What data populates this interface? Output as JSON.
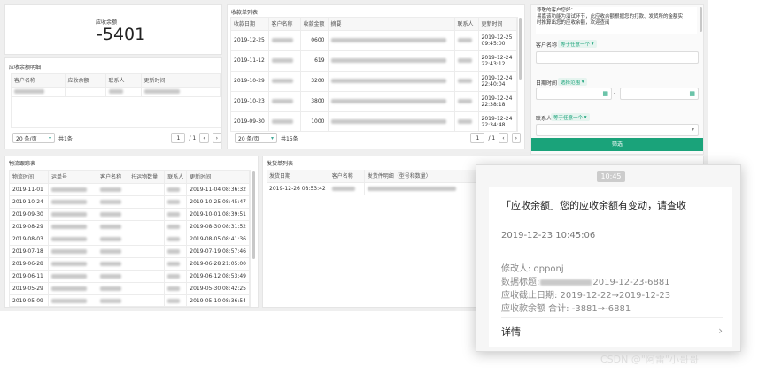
{
  "summary": {
    "label": "应收余额",
    "value": "-5401"
  },
  "receivable_detail": {
    "title": "应收余额明细",
    "columns": [
      "客户名称",
      "应收余额",
      "联系人",
      "更新时间"
    ],
    "rows": 1,
    "page_size": "20 条/页",
    "total": "共1条",
    "page": "1",
    "pages": "/ 1"
  },
  "payments": {
    "title": "收款单列表",
    "columns": [
      "收款日期",
      "客户名称",
      "收款金额",
      "摘要",
      "联系人",
      "更新时间"
    ],
    "rows": [
      {
        "date": "2019-12-25",
        "amount": "0600",
        "time1": "2019-12-25",
        "time2": "09:45:00"
      },
      {
        "date": "2019-11-12",
        "amount": "619",
        "time1": "2019-12-24",
        "time2": "22:43:12"
      },
      {
        "date": "2019-10-29",
        "amount": "3200",
        "time1": "2019-12-24",
        "time2": "22:40:04"
      },
      {
        "date": "2019-10-23",
        "amount": "3800",
        "time1": "2019-12-24",
        "time2": "22:38:18"
      },
      {
        "date": "2019-09-30",
        "amount": "1000",
        "time1": "2019-12-24",
        "time2": "22:34:48"
      },
      {
        "date": "",
        "amount": "",
        "time1": "2019-12-24",
        "time2": ""
      }
    ],
    "page_size": "20 条/页",
    "total": "共15条",
    "page": "1",
    "pages": "/ 1"
  },
  "filter": {
    "greeting": "尊敬的客户您好：",
    "note1": "易嘉该功能为演试环节，此应收余额根据您的打款、发货所的金额实",
    "note2": "时推算出您的应收余额，欢迎查阅",
    "customer_label": "客户名称",
    "customer_tag": "等于任意一个",
    "date_label": "日期时间",
    "date_tag": "选择范围",
    "contact_label": "联系人",
    "contact_tag": "等于任意一个",
    "submit": "筛选"
  },
  "logistics": {
    "title": "物流跟踪表",
    "columns": [
      "物流时间",
      "运单号",
      "客户名称",
      "托运物数量",
      "联系人",
      "更新时间"
    ],
    "rows": [
      {
        "date": "2019-11-01",
        "updated": "2019-11-04 08:36:32"
      },
      {
        "date": "2019-10-24",
        "updated": "2019-10-25 08:45:47"
      },
      {
        "date": "2019-09-30",
        "updated": "2019-10-01 08:39:51"
      },
      {
        "date": "2019-08-29",
        "updated": "2019-08-30 08:31:52"
      },
      {
        "date": "2019-08-03",
        "updated": "2019-08-05 08:41:36"
      },
      {
        "date": "2019-07-18",
        "updated": "2019-07-19 08:57:46"
      },
      {
        "date": "2019-06-28",
        "updated": "2019-06-28 21:05:00"
      },
      {
        "date": "2019-06-11",
        "updated": "2019-06-12 08:53:49"
      },
      {
        "date": "2019-05-29",
        "updated": "2019-05-30 08:42:25"
      },
      {
        "date": "2019-05-09",
        "updated": "2019-05-10 08:36:54"
      }
    ]
  },
  "shipments": {
    "title": "发货单列表",
    "columns": [
      "发货日期",
      "客户名称",
      "发货件明细（型号和数量）"
    ],
    "rows": [
      {
        "date": "2019-12-26 08:53:42"
      }
    ]
  },
  "notification": {
    "time": "10:45",
    "title": "「应收余额」您的应收余额有变动，请查收",
    "timestamp": "2019-12-23 10:45:06",
    "modifier": "修改人: opponj",
    "data_title_label": "数据标题:",
    "data_title_suffix": "2019-12-23-6881",
    "deadline": "应收截止日期: 2019-12-22→2019-12-23",
    "balance": "应收款余额 合计: -3881→-6881",
    "details": "详情"
  },
  "watermark": "CSDN @\"阿雷\"小哥哥"
}
